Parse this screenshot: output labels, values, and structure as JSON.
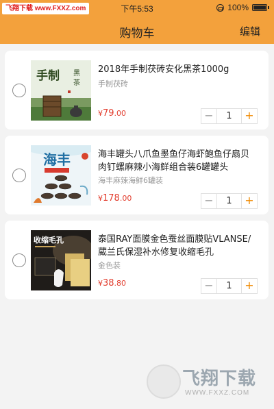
{
  "status_bar": {
    "watermark": "飞翔下载 www.FXXZ.com",
    "time": "下午5:53",
    "battery": "100%"
  },
  "navbar": {
    "title": "购物车",
    "edit_label": "编辑"
  },
  "colors": {
    "accent": "#f3a13c",
    "price": "#e23c2d",
    "plus": "#f08a00",
    "background": "#f3f3f3"
  },
  "cart": {
    "items": [
      {
        "title": "2018年手制茯砖安化黑茶1000g",
        "subtitle": "手制茯砖",
        "price_currency": "¥",
        "price_int": "79",
        "price_dec": ".00",
        "quantity": "1",
        "image_text": "手制 黑茶",
        "selected": false
      },
      {
        "title": "海丰罐头八爪鱼墨鱼仔海虾鲍鱼仔扇贝肉钉螺麻辣小海鲜组合装6罐罐头",
        "subtitle": "海丰麻辣海鲜6罐装",
        "price_currency": "¥",
        "price_int": "178",
        "price_dec": ".00",
        "quantity": "1",
        "image_text": "海丰",
        "selected": false
      },
      {
        "title": "泰国RAY面膜金色蚕丝面膜贴VLANSE/葳兰氏保湿补水修复收缩毛孔",
        "subtitle": "金色装",
        "price_currency": "¥",
        "price_int": "38",
        "price_dec": ".80",
        "quantity": "1",
        "image_text": "收缩毛孔",
        "selected": false
      }
    ],
    "stepper_minus": "−",
    "stepper_plus": "+"
  },
  "watermark_logo": {
    "text": "飞翔下载",
    "url": "WWW.FXXZ.COM"
  }
}
